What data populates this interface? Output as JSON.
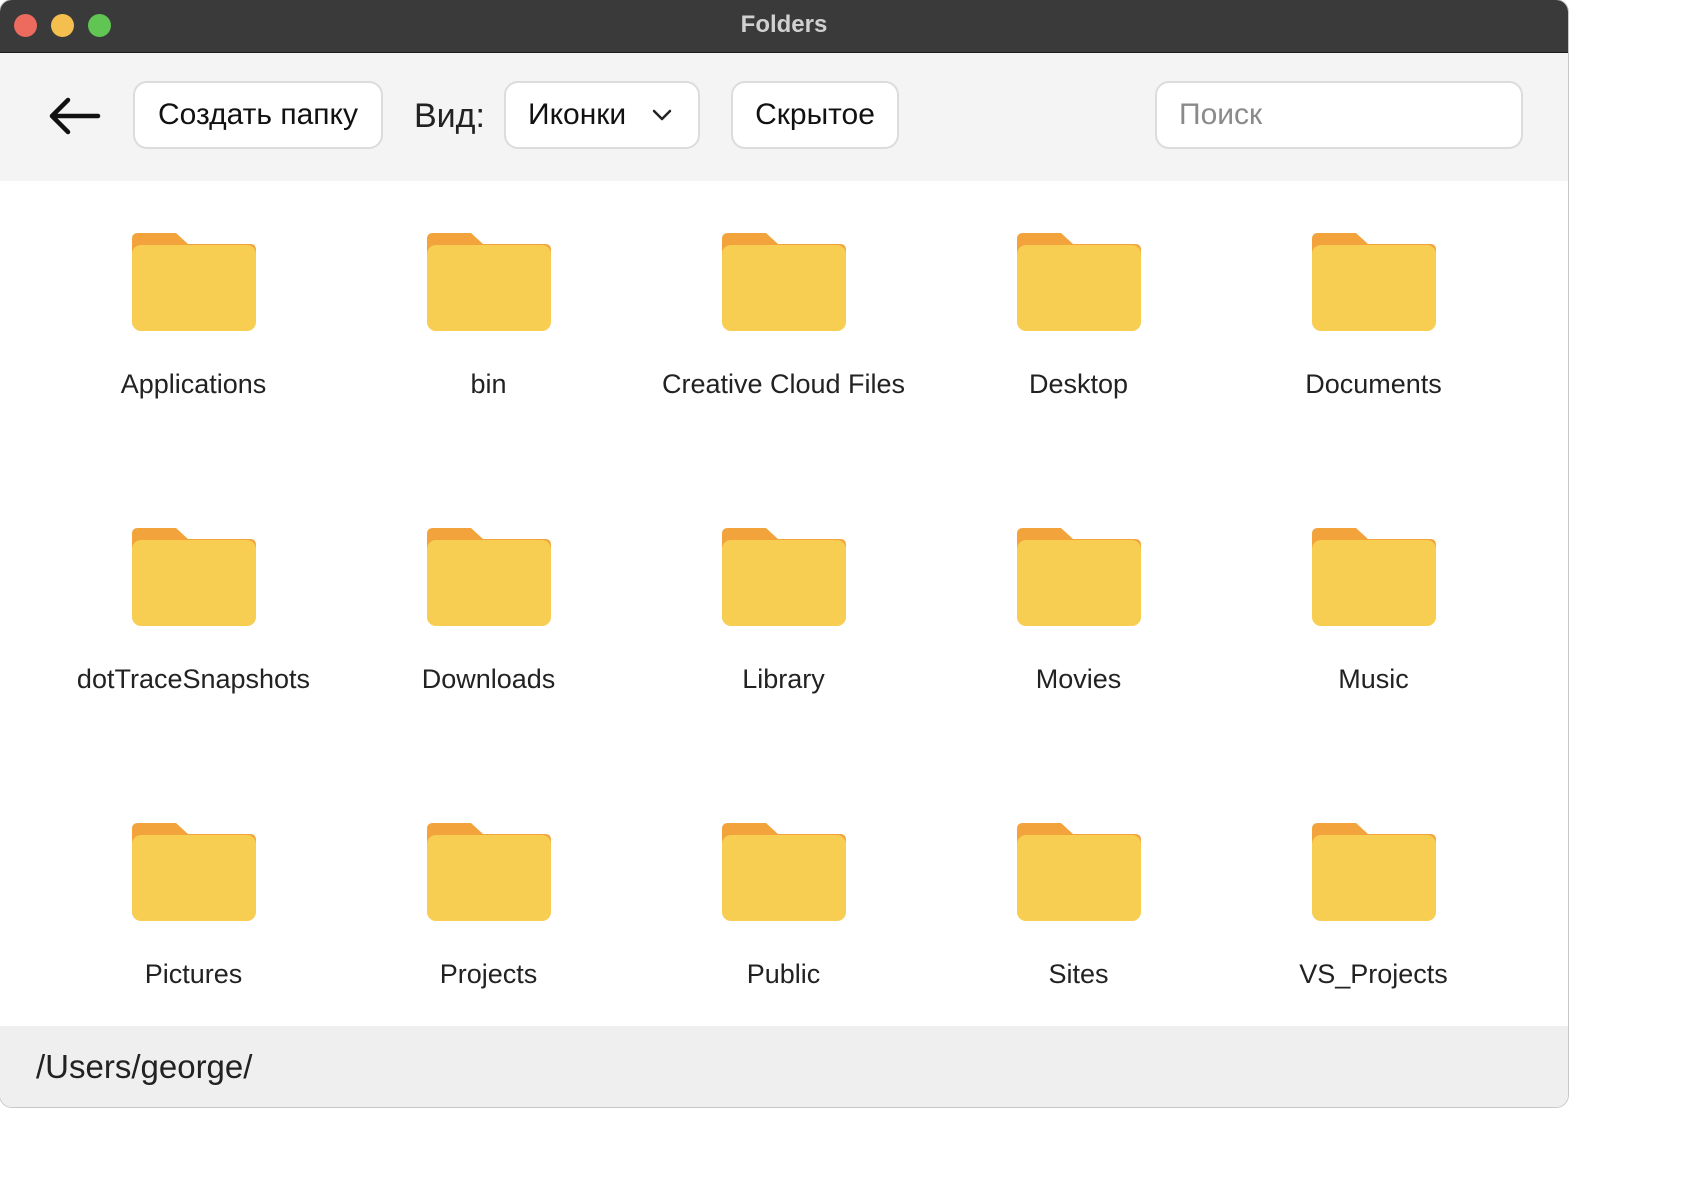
{
  "window": {
    "title": "Folders"
  },
  "toolbar": {
    "back_icon": "arrow-left-icon",
    "create_folder_label": "Создать папку",
    "view_label": "Вид:",
    "view_select_value": "Иконки",
    "hidden_label": "Скрытое",
    "search_placeholder": "Поиск",
    "search_value": ""
  },
  "folders": [
    {
      "name": "Applications"
    },
    {
      "name": "bin"
    },
    {
      "name": "Creative Cloud Files"
    },
    {
      "name": "Desktop"
    },
    {
      "name": "Documents"
    },
    {
      "name": "dotTraceSnapshots"
    },
    {
      "name": "Downloads"
    },
    {
      "name": "Library"
    },
    {
      "name": "Movies"
    },
    {
      "name": "Music"
    },
    {
      "name": "Pictures"
    },
    {
      "name": "Projects"
    },
    {
      "name": "Public"
    },
    {
      "name": "Sites"
    },
    {
      "name": "VS_Projects"
    }
  ],
  "status": {
    "path": "/Users/george/"
  },
  "colors": {
    "folder_body": "#f7cd52",
    "folder_tab": "#f2a33c",
    "titlebar": "#3a3a3a",
    "toolbar": "#f4f4f4",
    "statusbar": "#efefef"
  }
}
